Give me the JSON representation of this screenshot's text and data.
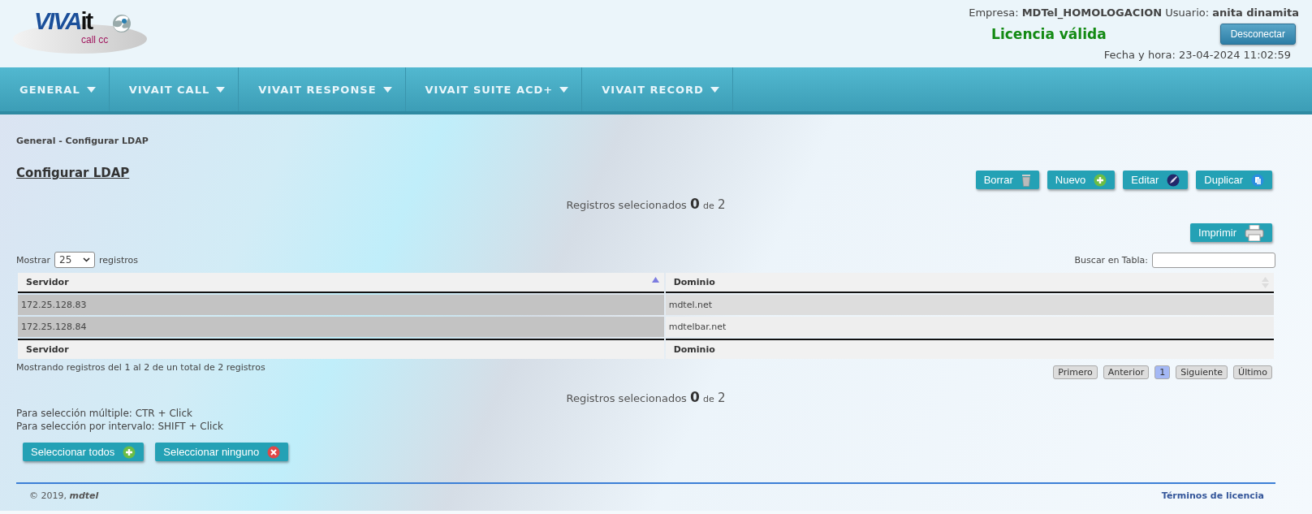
{
  "logo": {
    "brand_a": "VIVA",
    "brand_b": "it",
    "tagline": "call cc"
  },
  "account": {
    "line": "Empresa: **MDTel_HOMOLOGACION** Usuario: **anita dinamita**",
    "license": "Licencia válida",
    "license_valid": true,
    "logout": "Desconectar",
    "datetime": "Fecha y hora: 23-04-2024 11:02:59"
  },
  "nav": [
    {
      "label": "GENERAL"
    },
    {
      "label": "VIVAIT CALL"
    },
    {
      "label": "VIVAIT RESPONSE"
    },
    {
      "label": "VIVAIT SUITE ACD+"
    },
    {
      "label": "VIVAIT RECORD"
    }
  ],
  "breadcrumb": "General - Configurar LDAP",
  "title": "Configurar LDAP",
  "actions": [
    {
      "label": "Borrar",
      "kind": "delete"
    },
    {
      "label": "Nuevo",
      "kind": "add"
    },
    {
      "label": "Editar",
      "kind": "edit"
    },
    {
      "label": "Duplicar",
      "kind": "duplicate"
    }
  ],
  "selected_count_top": {
    "label": "Registros selecionados",
    "count": "0",
    "of": "de",
    "total": "2"
  },
  "print_button": "Imprimir",
  "length": {
    "before": "Mostrar",
    "value": "25",
    "after": "registros"
  },
  "search": {
    "label": "Buscar en Tabla:"
  },
  "table": {
    "columns": [
      {
        "label": "Servidor",
        "sorted": true
      },
      {
        "label": "Dominio",
        "sorted": false
      }
    ],
    "footer_columns": [
      "Servidor",
      "Dominio"
    ],
    "rows": [
      [
        "172.25.128.83",
        "mdtel.net"
      ],
      [
        "172.25.128.84",
        "mdtelbar.net"
      ]
    ]
  },
  "info": "Mostrando registros del 1 al 2 de un total de 2 registros",
  "pager": [
    {
      "label": "Primero",
      "selected": false
    },
    {
      "label": "Anterior",
      "selected": false
    },
    {
      "label": "1",
      "selected": true
    },
    {
      "label": "Siguiente",
      "selected": false
    },
    {
      "label": "Último",
      "selected": false
    }
  ],
  "selected_count_bottom": {
    "label": "Registros selecionados",
    "count": "0",
    "of": "de",
    "total": "2"
  },
  "hints": [
    "Para selección múltiple: CTR + Click",
    "Para selección por intervalo: SHIFT + Click"
  ],
  "select_buttons": [
    {
      "label": "Seleccionar todos",
      "kind": "add"
    },
    {
      "label": "Seleccionar ninguno",
      "kind": "remove"
    }
  ],
  "footer": {
    "copyright": "© 2019, ",
    "brand": "mdtel",
    "terms": "Términos de licencia"
  }
}
